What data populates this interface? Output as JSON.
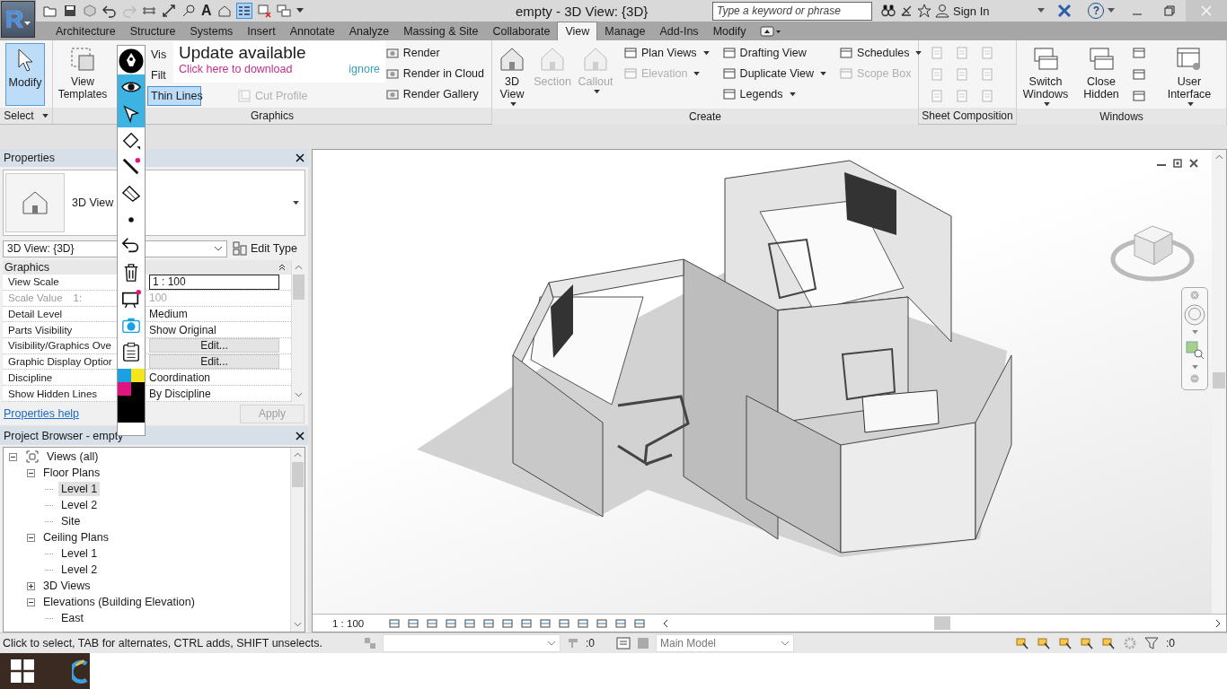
{
  "title_bar": {
    "app_letter": "R",
    "text_tool": "A",
    "title": "empty - 3D View: {3D}",
    "search": {
      "placeholder": "Type a keyword or phrase"
    },
    "sign_in": "Sign In",
    "help": "?"
  },
  "tabs": [
    {
      "label": "Architecture",
      "selected": false
    },
    {
      "label": "Structure",
      "selected": false
    },
    {
      "label": "Systems",
      "selected": false
    },
    {
      "label": "Insert",
      "selected": false
    },
    {
      "label": "Annotate",
      "selected": false
    },
    {
      "label": "Analyze",
      "selected": false
    },
    {
      "label": "Massing & Site",
      "selected": false
    },
    {
      "label": "Collaborate",
      "selected": false
    },
    {
      "label": "View",
      "selected": true
    },
    {
      "label": "Manage",
      "selected": false
    },
    {
      "label": "Add-Ins",
      "selected": false
    },
    {
      "label": "Modify",
      "selected": false
    }
  ],
  "ribbon": {
    "select": {
      "title": "Select",
      "modify": {
        "label": "Modify",
        "active": true
      }
    },
    "graphics": {
      "title": "Graphics",
      "view_templates": "View Templates",
      "small": [
        {
          "label": "Vis",
          "active": false
        },
        {
          "label": "Filt",
          "active": false
        },
        {
          "label": "Thin Lines",
          "active": true
        }
      ],
      "cut_profile": {
        "label": "Cut Profile",
        "disabled": true
      },
      "render": [
        "Render",
        "Render  in Cloud",
        "Render  Gallery"
      ]
    },
    "update_notice": {
      "title": "Update available",
      "link": "Click here to download",
      "dismiss": "ignore"
    },
    "create": {
      "title": "Create",
      "large": [
        {
          "label": "3D View",
          "disabled": false,
          "dropdown": true
        },
        {
          "label": "Section",
          "disabled": true,
          "dropdown": false
        },
        {
          "label": "Callout",
          "disabled": true,
          "dropdown": true
        }
      ],
      "small_columns": [
        [
          {
            "label": "Plan  Views",
            "disabled": false,
            "dropdown": true
          },
          {
            "label": "Elevation",
            "disabled": true,
            "dropdown": true
          }
        ],
        [
          {
            "label": "Drafting  View",
            "disabled": false,
            "dropdown": false
          },
          {
            "label": "Duplicate  View",
            "disabled": false,
            "dropdown": true
          },
          {
            "label": "Legends",
            "disabled": false,
            "dropdown": true
          }
        ],
        [
          {
            "label": "Schedules",
            "disabled": false,
            "dropdown": true
          },
          {
            "label": "Scope  Box",
            "disabled": true,
            "dropdown": false
          }
        ]
      ]
    },
    "sheet_composition": {
      "title": "Sheet Composition"
    },
    "windows": {
      "title": "Windows",
      "large": [
        {
          "label": "Switch Windows",
          "dropdown": true
        },
        {
          "label": "Close Hidden",
          "dropdown": false
        }
      ],
      "user_interface": {
        "label": "User Interface",
        "dropdown": true
      }
    }
  },
  "annotation_toolbar": {
    "tools": [
      {
        "kind": "pen",
        "selected": false
      },
      {
        "kind": "eye",
        "selected": true
      },
      {
        "kind": "pointer",
        "selected": true
      },
      {
        "kind": "highlighter",
        "selected": false
      },
      {
        "kind": "line",
        "selected": false
      },
      {
        "kind": "eraser",
        "selected": false
      },
      {
        "kind": "dot",
        "selected": false
      },
      {
        "kind": "undo",
        "selected": false
      },
      {
        "kind": "trash",
        "selected": false
      },
      {
        "kind": "easel",
        "selected": false
      },
      {
        "kind": "camera",
        "selected": false
      },
      {
        "kind": "clipboard",
        "selected": false
      }
    ],
    "palette": [
      {
        "color": "#1ba1e2"
      },
      {
        "color": "#f5e61c"
      },
      {
        "color": "#e0157e"
      },
      {
        "color": "#000000"
      }
    ]
  },
  "properties": {
    "title": "Properties",
    "type": "3D View",
    "instance": "3D View: {3D}",
    "edit_type": "Edit Type",
    "group": "Graphics",
    "rows": [
      {
        "label": "View Scale",
        "value": "1 : 100",
        "kind": "input",
        "disabled": false
      },
      {
        "label": "Scale Value",
        "suffix": "1:",
        "value": "100",
        "kind": "text",
        "disabled": true
      },
      {
        "label": "Detail Level",
        "value": "Medium",
        "kind": "text",
        "disabled": false
      },
      {
        "label": "Parts Visibility",
        "value": "Show Original",
        "kind": "text",
        "disabled": false
      },
      {
        "label": "Visibility/Graphics Ove",
        "value": "Edit...",
        "kind": "button",
        "disabled": false
      },
      {
        "label": "Graphic Display Optior",
        "value": "Edit...",
        "kind": "button",
        "disabled": false
      },
      {
        "label": "Discipline",
        "value": "Coordination",
        "kind": "text",
        "disabled": false
      },
      {
        "label": "Show Hidden Lines",
        "value": "By Discipline",
        "kind": "text",
        "disabled": false
      }
    ],
    "help": "Properties help",
    "apply": {
      "label": "Apply",
      "disabled": true
    }
  },
  "project_browser": {
    "title": "Project Browser - empty",
    "tree": [
      {
        "label": "Views (all)",
        "expanded": true,
        "selected": false,
        "children": [
          {
            "label": "Floor Plans",
            "expanded": true,
            "selected": false,
            "children": [
              {
                "label": "Level 1",
                "selected": true
              },
              {
                "label": "Level 2",
                "selected": false
              },
              {
                "label": "Site",
                "selected": false
              }
            ]
          },
          {
            "label": "Ceiling Plans",
            "expanded": true,
            "selected": false,
            "children": [
              {
                "label": "Level 1",
                "selected": false
              },
              {
                "label": "Level 2",
                "selected": false
              }
            ]
          },
          {
            "label": "3D Views",
            "expanded": false,
            "selected": false
          },
          {
            "label": "Elevations (Building Elevation)",
            "expanded": true,
            "selected": false,
            "children": [
              {
                "label": "East",
                "selected": false
              }
            ]
          }
        ]
      }
    ]
  },
  "view_bar": {
    "scale": "1 : 100"
  },
  "status_bar": {
    "message": "Click to select, TAB for alternates, CTRL adds, SHIFT unselects.",
    "selection_count": ":0",
    "workset": "Main Model",
    "filter_count": ":0"
  }
}
